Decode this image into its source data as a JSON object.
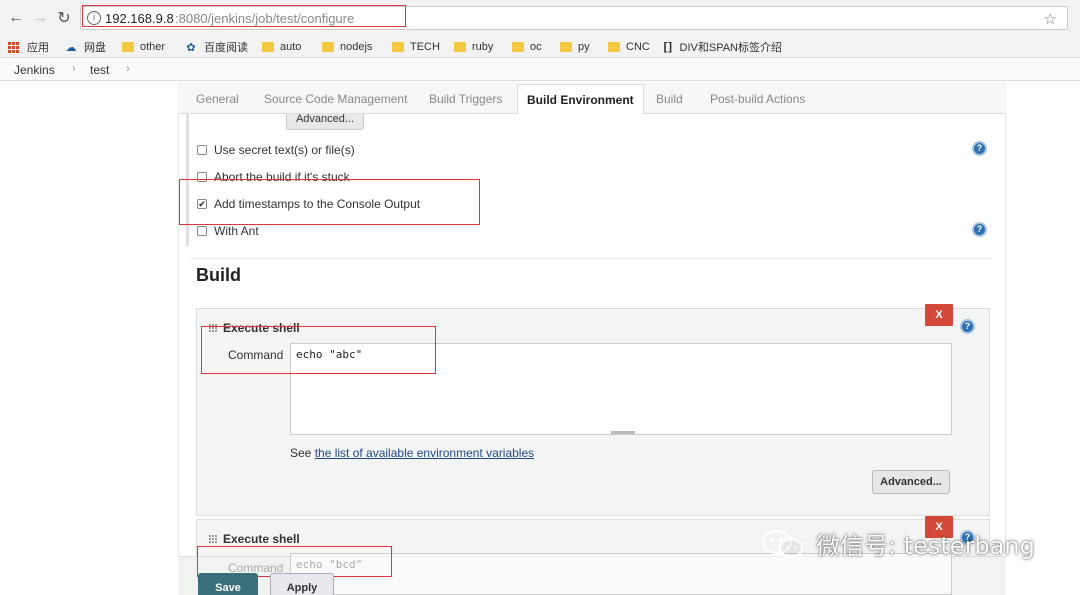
{
  "browser": {
    "url_host": "192.168.9.8",
    "url_path": ":8080/jenkins/job/test/configure",
    "info_glyph": "i"
  },
  "bookmarks": {
    "items": [
      {
        "label": "应用",
        "icon": "apps-grid-icon"
      },
      {
        "label": "网盘",
        "icon": "cloud-icon"
      },
      {
        "label": "other",
        "icon": "folder-icon"
      },
      {
        "label": "百度阅读",
        "icon": "paw-icon"
      },
      {
        "label": "auto",
        "icon": "folder-icon"
      },
      {
        "label": "nodejs",
        "icon": "folder-icon"
      },
      {
        "label": "TECH",
        "icon": "folder-icon"
      },
      {
        "label": "ruby",
        "icon": "folder-icon"
      },
      {
        "label": "oc",
        "icon": "folder-icon"
      },
      {
        "label": "py",
        "icon": "folder-icon"
      },
      {
        "label": "CNC",
        "icon": "folder-icon"
      },
      {
        "label": "DIV和SPAN标签介绍",
        "icon": "bracket-icon"
      }
    ]
  },
  "breadcrumb": {
    "items": [
      "Jenkins",
      "test"
    ],
    "separator": "›"
  },
  "tabs": [
    {
      "label": "General",
      "active": false
    },
    {
      "label": "Source Code Management",
      "active": false
    },
    {
      "label": "Build Triggers",
      "active": false
    },
    {
      "label": "Build Environment",
      "active": true
    },
    {
      "label": "Build",
      "active": false
    },
    {
      "label": "Post-build Actions",
      "active": false
    }
  ],
  "build_environment": {
    "advanced_label": "Advanced...",
    "options": [
      {
        "label": "Use secret text(s) or file(s)",
        "checked": false
      },
      {
        "label": "Abort the build if it's stuck",
        "checked": false
      },
      {
        "label": "Add timestamps to the Console Output",
        "checked": true
      },
      {
        "label": "With Ant",
        "checked": false
      }
    ],
    "check_glyph": "✔",
    "help_glyph": "?"
  },
  "build": {
    "section_title": "Build",
    "steps": [
      {
        "title": "Execute shell",
        "command_label": "Command",
        "command": "echo \"abc\"",
        "delete_label": "X"
      },
      {
        "title": "Execute shell",
        "command_label": "Command",
        "command": "echo \"bcd\"",
        "delete_label": "X"
      }
    ],
    "env_vars_prefix": "See ",
    "env_vars_link": "the list of available environment variables",
    "advanced_label": "Advanced..."
  },
  "actions": {
    "save_label": "Save",
    "apply_label": "Apply"
  },
  "watermark": {
    "text": "微信号: testerbang"
  },
  "colors": {
    "annotation_red": "#d9363e",
    "delete_red": "#d24939",
    "save_teal": "#3a6f7a",
    "link_blue": "#204a87"
  }
}
